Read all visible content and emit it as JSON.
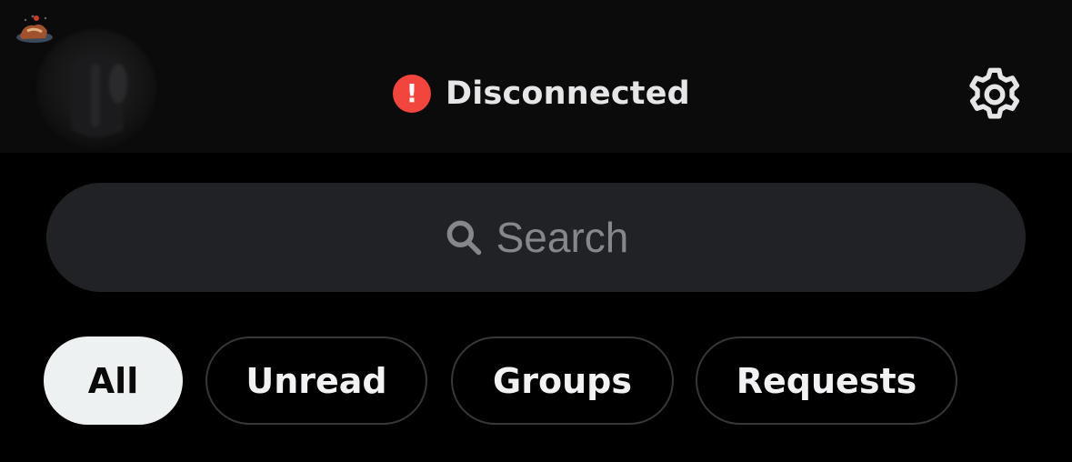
{
  "header": {
    "status_icon": "exclamation-icon",
    "status_glyph": "!",
    "status_text": "Disconnected",
    "status_color": "#f2453d",
    "settings_icon": "gear-icon"
  },
  "search": {
    "icon": "search-icon",
    "placeholder": "Search"
  },
  "filters": [
    {
      "label": "All",
      "selected": true
    },
    {
      "label": "Unread",
      "selected": false
    },
    {
      "label": "Groups",
      "selected": false
    },
    {
      "label": "Requests",
      "selected": false
    }
  ],
  "colors": {
    "background": "#000000",
    "header_background": "#0b0b0c",
    "search_background": "#202226",
    "chip_border": "#35373b",
    "chip_active_background": "#eef1f2"
  }
}
